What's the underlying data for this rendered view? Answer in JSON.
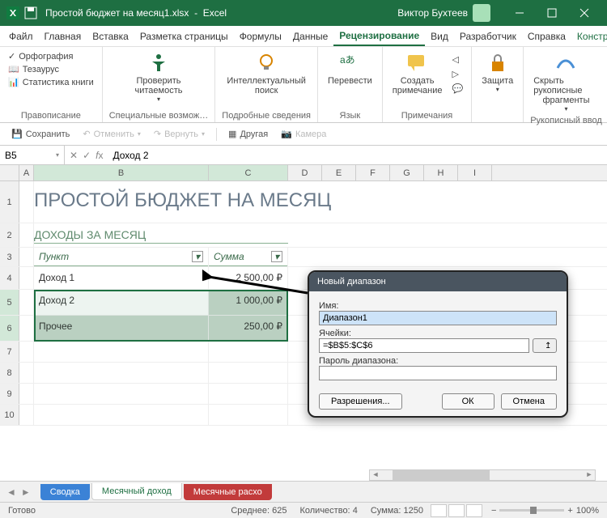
{
  "titlebar": {
    "filename": "Простой бюджет на месяц1.xlsx",
    "app": "Excel",
    "user": "Виктор Бухтеев"
  },
  "menu": {
    "file": "Файл",
    "home": "Главная",
    "insert": "Вставка",
    "layout": "Разметка страницы",
    "formulas": "Формулы",
    "data": "Данные",
    "review": "Рецензирование",
    "view": "Вид",
    "developer": "Разработчик",
    "help": "Справка",
    "tabledesign": "Конструктор таблиц"
  },
  "ribbon": {
    "g1": {
      "spelling": "Орфография",
      "thesaurus": "Тезаурус",
      "stats": "Статистика книги",
      "title": "Правописание"
    },
    "g2": {
      "check": "Проверить",
      "read": "читаемость",
      "title": "Специальные возмож…"
    },
    "g3": {
      "smart": "Интеллектуальный",
      "lookup": "поиск",
      "title": "Подробные сведения"
    },
    "g4": {
      "translate": "Перевести",
      "title": "Язык"
    },
    "g5": {
      "new": "Создать",
      "comment": "примечание",
      "title": "Примечания"
    },
    "g6": {
      "protect": "Защита"
    },
    "g7": {
      "hide": "Скрыть рукописные",
      "frag": "фрагменты",
      "title": "Рукописный ввод"
    }
  },
  "qat": {
    "save": "Сохранить",
    "undo": "Отменить",
    "redo": "Вернуть",
    "other": "Другая",
    "camera": "Камера"
  },
  "formula": {
    "cellref": "B5",
    "value": "Доход 2"
  },
  "cols": [
    "A",
    "B",
    "C",
    "D",
    "E",
    "F",
    "G",
    "H",
    "I"
  ],
  "sheet": {
    "title": "ПРОСТОЙ БЮДЖЕТ НА МЕСЯЦ",
    "section": "ДОХОДЫ ЗА МЕСЯЦ",
    "h_item": "Пункт",
    "h_sum": "Сумма",
    "rows": [
      {
        "item": "Доход 1",
        "sum": "2 500,00 ₽"
      },
      {
        "item": "Доход 2",
        "sum": "1 000,00 ₽"
      },
      {
        "item": "Прочее",
        "sum": "250,00 ₽"
      }
    ]
  },
  "dialog": {
    "title": "Новый диапазон",
    "l_name": "Имя:",
    "v_name": "Диапазон1",
    "l_cells": "Ячейки:",
    "v_cells": "=$B$5:$C$6",
    "l_pwd": "Пароль диапазона:",
    "perm": "Разрешения...",
    "ok": "ОК",
    "cancel": "Отмена"
  },
  "tabs": {
    "t1": "Сводка",
    "t2": "Месячный доход",
    "t3": "Месячные расхо"
  },
  "status": {
    "ready": "Готово",
    "avg_l": "Среднее:",
    "avg_v": "625",
    "cnt_l": "Количество:",
    "cnt_v": "4",
    "sum_l": "Сумма:",
    "sum_v": "1250",
    "zoom": "100%"
  }
}
